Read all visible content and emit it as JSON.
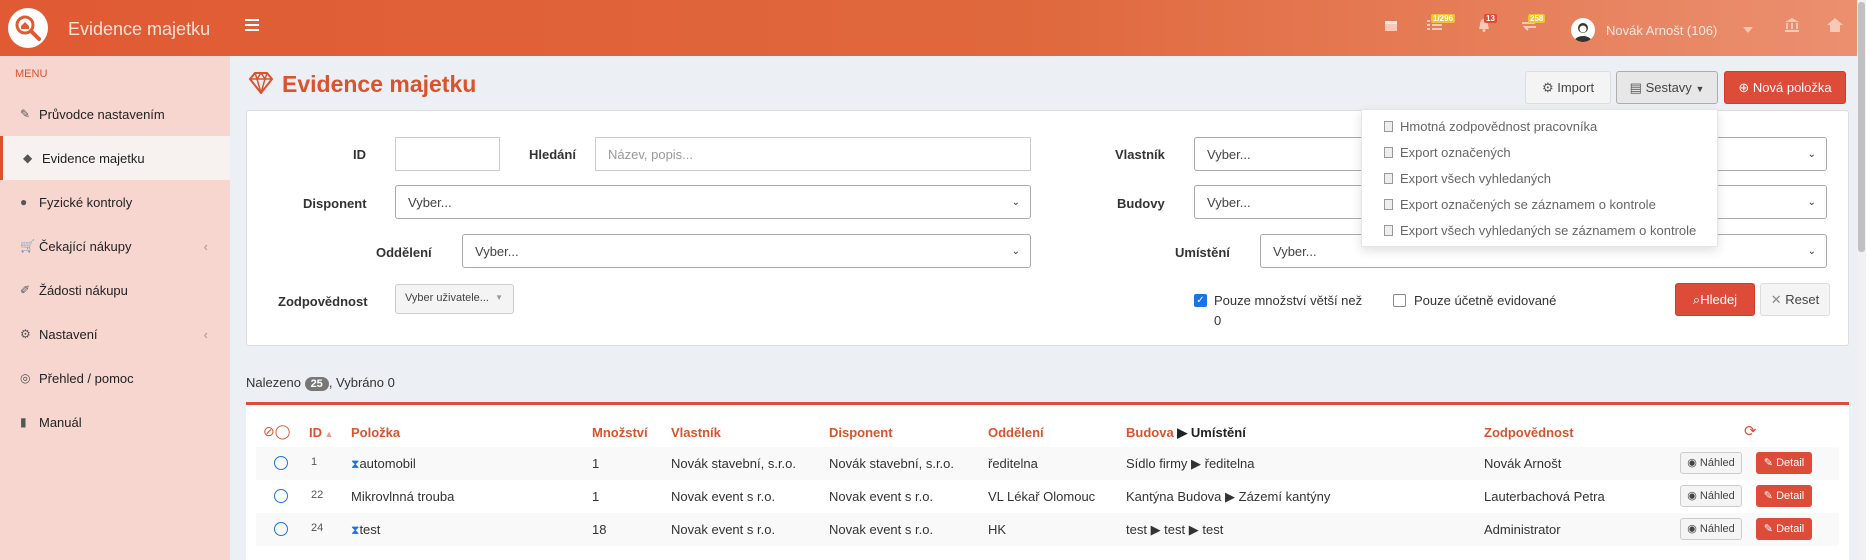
{
  "app": {
    "title": "Evidence majetku",
    "badges": {
      "tasks": "1/296",
      "alerts": "13",
      "transfers": "258"
    },
    "user": "Novák Arnošt (106)"
  },
  "sidebar": {
    "header": "MENU",
    "items": [
      {
        "label": "Průvodce nastavením",
        "icon": "pencil-icon"
      },
      {
        "label": "Evidence majetku",
        "icon": "diamond-icon"
      },
      {
        "label": "Fyzické kontroly",
        "icon": "check-circle-icon"
      },
      {
        "label": "Čekající nákupy",
        "icon": "cart-icon"
      },
      {
        "label": "Žádosti nákupu",
        "icon": "edit-icon"
      },
      {
        "label": "Nastavení",
        "icon": "gears-icon"
      },
      {
        "label": "Přehled / pomoc",
        "icon": "globe-icon"
      },
      {
        "label": "Manuál",
        "icon": "book-icon"
      }
    ]
  },
  "page": {
    "title": "Evidence majetku",
    "buttons": {
      "import": "Import",
      "reports": "Sestavy",
      "new": "Nová položka"
    }
  },
  "reports_menu": [
    "Hmotná zodpovědnost pracovníka",
    "Export označených",
    "Export všech vyhledaných",
    "Export označených se záznamem o kontrole",
    "Export všech vyhledaných se záznamem o kontrole"
  ],
  "filters": {
    "id_label": "ID",
    "search_label": "Hledání",
    "search_placeholder": "Název, popis...",
    "owner_label": "Vlastník",
    "disponent_label": "Disponent",
    "building_label": "Budovy",
    "department_label": "Oddělení",
    "location_label": "Umístění",
    "responsibility_label": "Zodpovědnost",
    "select_placeholder": "Vyber...",
    "user_placeholder": "Vyber uživatele...",
    "qty_check_label": "Pouze množství větší než",
    "qty_value": "0",
    "accounting_check_label": "Pouze účetně evidované",
    "search_button": "Hledej",
    "reset_button": "Reset"
  },
  "summary": {
    "found_label": "Nalezeno",
    "count": "25",
    "selected_label": ", Vybráno 0"
  },
  "table": {
    "headers": {
      "id": "ID",
      "item": "Položka",
      "qty": "Množství",
      "owner": "Vlastník",
      "disponent": "Disponent",
      "department": "Oddělení",
      "building": "Budova",
      "location": "Umístění",
      "responsibility": "Zodpovědnost"
    },
    "rows": [
      {
        "id": "1",
        "item": "automobil",
        "pending": true,
        "qty": "1",
        "owner": "Novák stavební, s.r.o.",
        "disponent": "Novák stavební, s.r.o.",
        "department": "ředitelna",
        "place": "Sídlo firmy ▶ ředitelna",
        "resp": "Novák Arnošt"
      },
      {
        "id": "22",
        "item": "Mikrovlnná trouba",
        "pending": false,
        "qty": "1",
        "owner": "Novak event s r.o.",
        "disponent": "Novak event s r.o.",
        "department": "VL Lékař Olomouc",
        "place": "Kantýna Budova ▶ Zázemí kantýny",
        "resp": "Lauterbachová Petra"
      },
      {
        "id": "24",
        "item": "test",
        "pending": true,
        "qty": "18",
        "owner": "Novak event s r.o.",
        "disponent": "Novak event s r.o.",
        "department": "HK",
        "place": "test ▶ test ▶ test",
        "resp": "Administrator"
      }
    ],
    "preview_label": "Náhled",
    "detail_label": "Detail"
  }
}
